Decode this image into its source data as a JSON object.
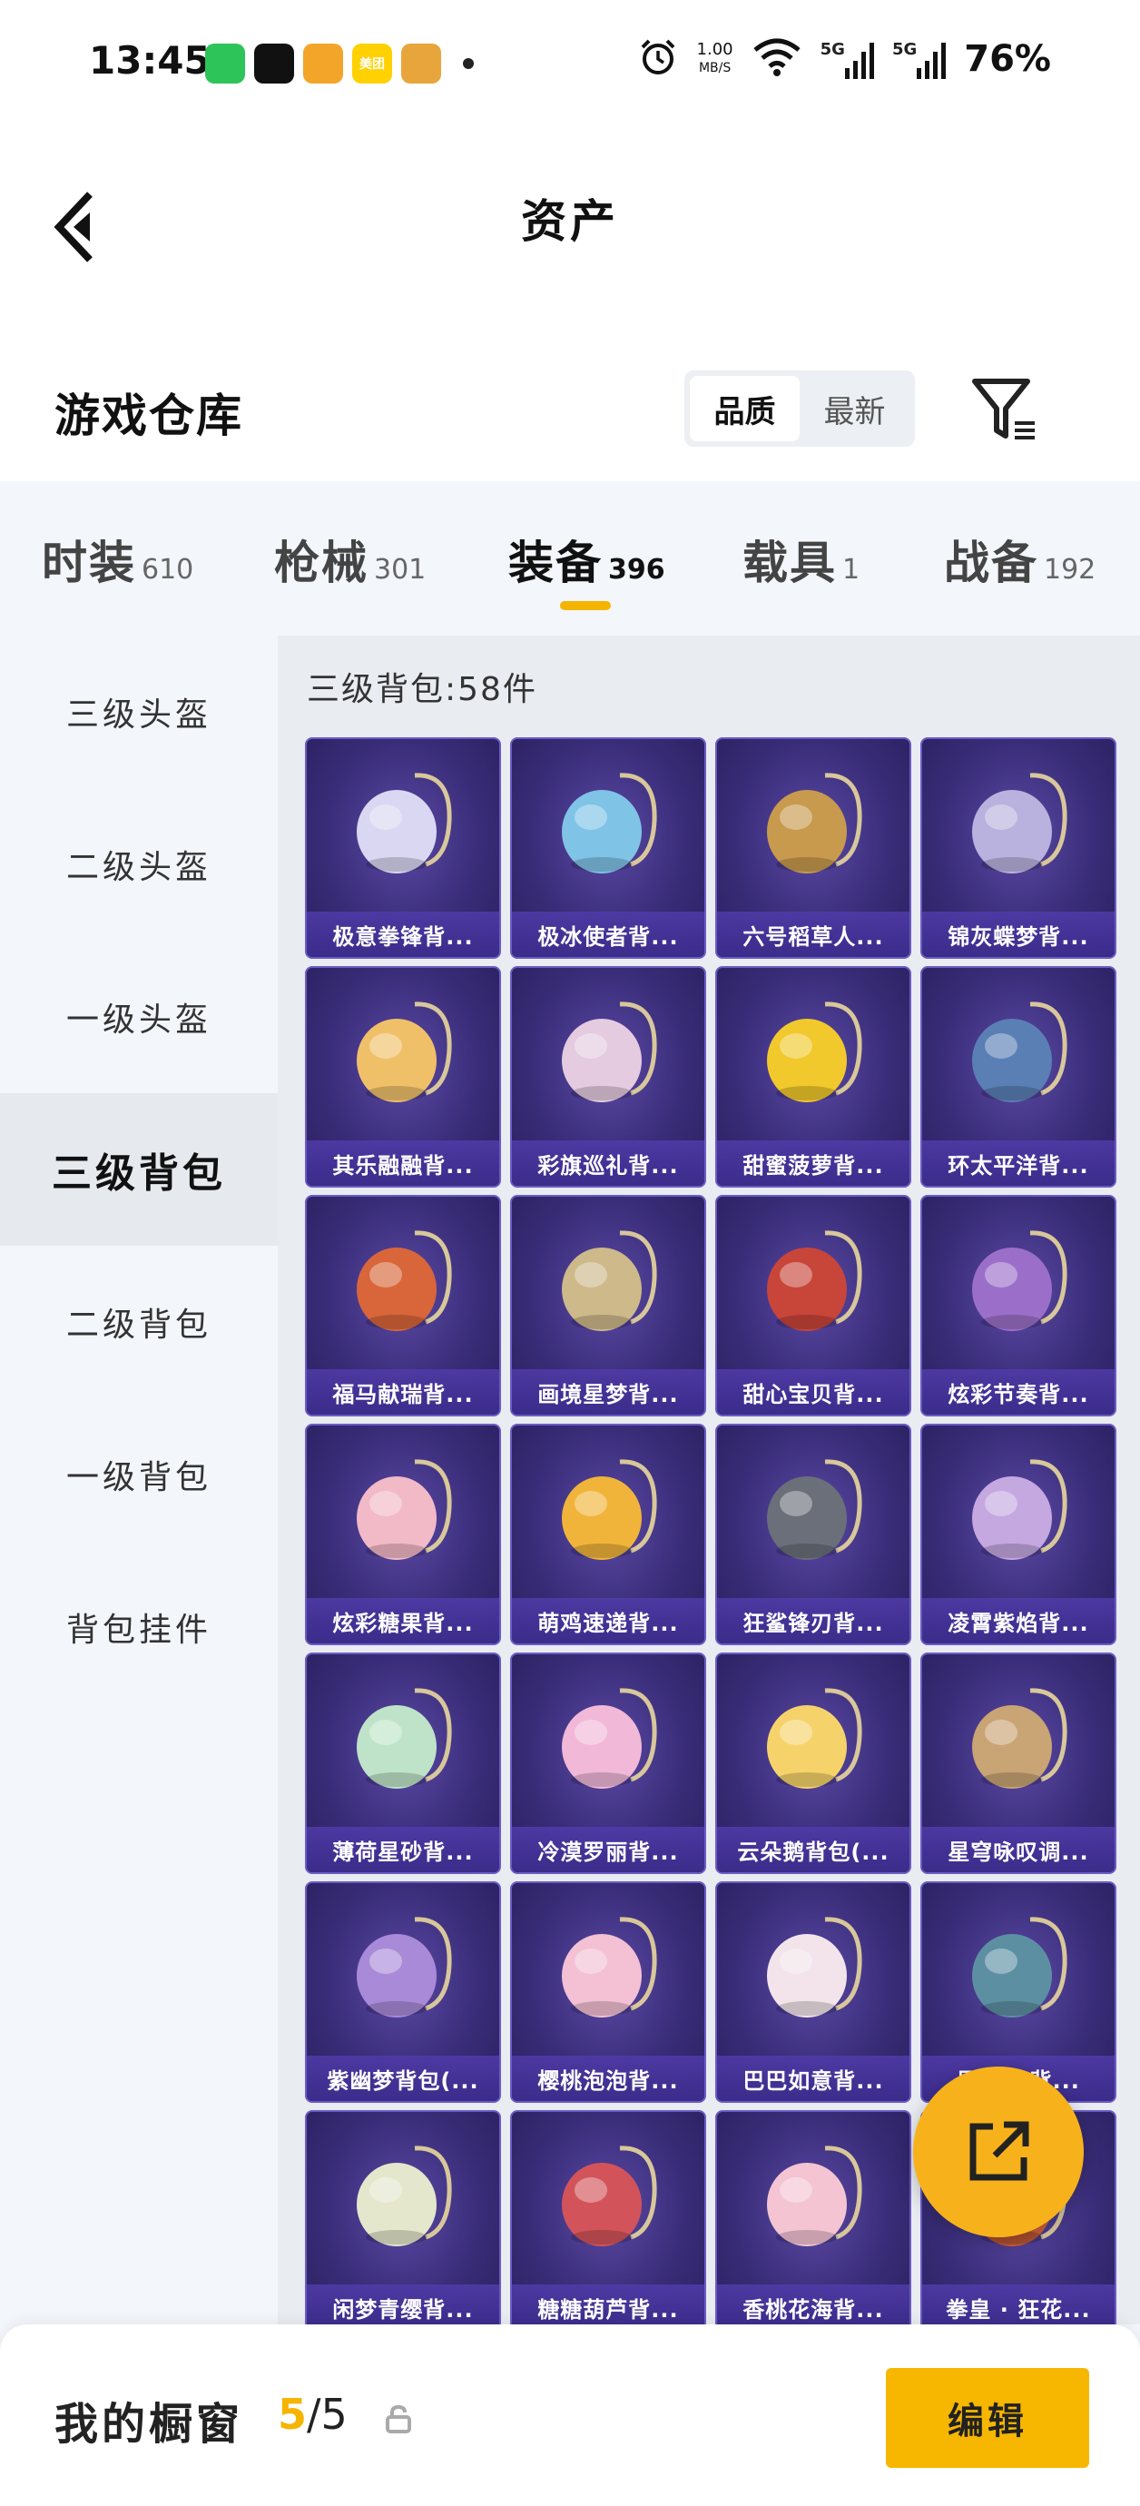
{
  "status_bar": {
    "time": "13:45",
    "apps": [
      {
        "icon": "wechat-icon",
        "color": "#2dc45a",
        "label": ""
      },
      {
        "icon": "tiktok-icon",
        "color": "#111111",
        "label": ""
      },
      {
        "icon": "video-app-icon",
        "color": "#f3a52a",
        "label": ""
      },
      {
        "icon": "meituan-icon",
        "color": "#ffd100",
        "label": "美团"
      },
      {
        "icon": "game-app-icon",
        "color": "#e8a53b",
        "label": ""
      }
    ],
    "net_speed_value": "1.00",
    "net_speed_unit": "MB/S",
    "signal_1": "5G",
    "signal_2": "5G",
    "battery": "76%"
  },
  "header": {
    "title": "资产"
  },
  "section": {
    "title": "游戏仓库",
    "sort_options": [
      "品质",
      "最新"
    ],
    "sort_active": "品质"
  },
  "tabs": [
    {
      "label": "时装",
      "count": "610"
    },
    {
      "label": "枪械",
      "count": "301"
    },
    {
      "label": "装备",
      "count": "396",
      "active": true
    },
    {
      "label": "载具",
      "count": "1"
    },
    {
      "label": "战备",
      "count": "192"
    }
  ],
  "sidebar": {
    "items": [
      {
        "label": "三级头盔"
      },
      {
        "label": "二级头盔"
      },
      {
        "label": "一级头盔"
      },
      {
        "label": "三级背包",
        "active": true
      },
      {
        "label": "二级背包"
      },
      {
        "label": "一级背包"
      },
      {
        "label": "背包挂件"
      }
    ]
  },
  "grid": {
    "caption": "三级背包:58件",
    "items": [
      {
        "name": "极意拳锋背...",
        "color": "#d9d7f2"
      },
      {
        "name": "极冰使者背...",
        "color": "#7fc3e6"
      },
      {
        "name": "六号稻草人...",
        "color": "#c89a4e"
      },
      {
        "name": "锦灰蝶梦背...",
        "color": "#b9b2de"
      },
      {
        "name": "其乐融融背...",
        "color": "#f0c069"
      },
      {
        "name": "彩旗巡礼背...",
        "color": "#e4cbe0"
      },
      {
        "name": "甜蜜菠萝背...",
        "color": "#f1c92c"
      },
      {
        "name": "环太平洋背...",
        "color": "#5a7fb5"
      },
      {
        "name": "福马献瑞背...",
        "color": "#d8663a"
      },
      {
        "name": "画境星梦背...",
        "color": "#cdb98a"
      },
      {
        "name": "甜心宝贝背...",
        "color": "#c8453a"
      },
      {
        "name": "炫彩节奏背...",
        "color": "#9b6fc9"
      },
      {
        "name": "炫彩糖果背...",
        "color": "#f2b9c7"
      },
      {
        "name": "萌鸡速递背...",
        "color": "#f0b43a"
      },
      {
        "name": "狂鲨锋刃背...",
        "color": "#6a6f7a"
      },
      {
        "name": "凌霄紫焰背...",
        "color": "#c5a8e0"
      },
      {
        "name": "薄荷星砂背...",
        "color": "#bfe3c8"
      },
      {
        "name": "冷漠罗丽背...",
        "color": "#f1b8d8"
      },
      {
        "name": "云朵鹅背包(...",
        "color": "#f6d36a"
      },
      {
        "name": "星穹咏叹调...",
        "color": "#c9a474"
      },
      {
        "name": "紫幽梦背包(...",
        "color": "#a98ad8"
      },
      {
        "name": "樱桃泡泡背...",
        "color": "#f3c0d4"
      },
      {
        "name": "巴巴如意背...",
        "color": "#f2e4ea"
      },
      {
        "name": "异域...背...",
        "color": "#5d8fa3"
      },
      {
        "name": "闲梦青缨背...",
        "color": "#e4e7cc"
      },
      {
        "name": "糖糖葫芦背...",
        "color": "#d2545a"
      },
      {
        "name": "香桃花海背...",
        "color": "#f4c4d3"
      },
      {
        "name": "拳皇 · 狂花...",
        "color": "#d1603a"
      }
    ]
  },
  "bottom": {
    "label": "我的橱窗",
    "count_current": "5",
    "count_total": "/5",
    "edit_label": "编辑"
  },
  "colors": {
    "accent": "#f5b400",
    "card_bg": "#3a2d79"
  }
}
